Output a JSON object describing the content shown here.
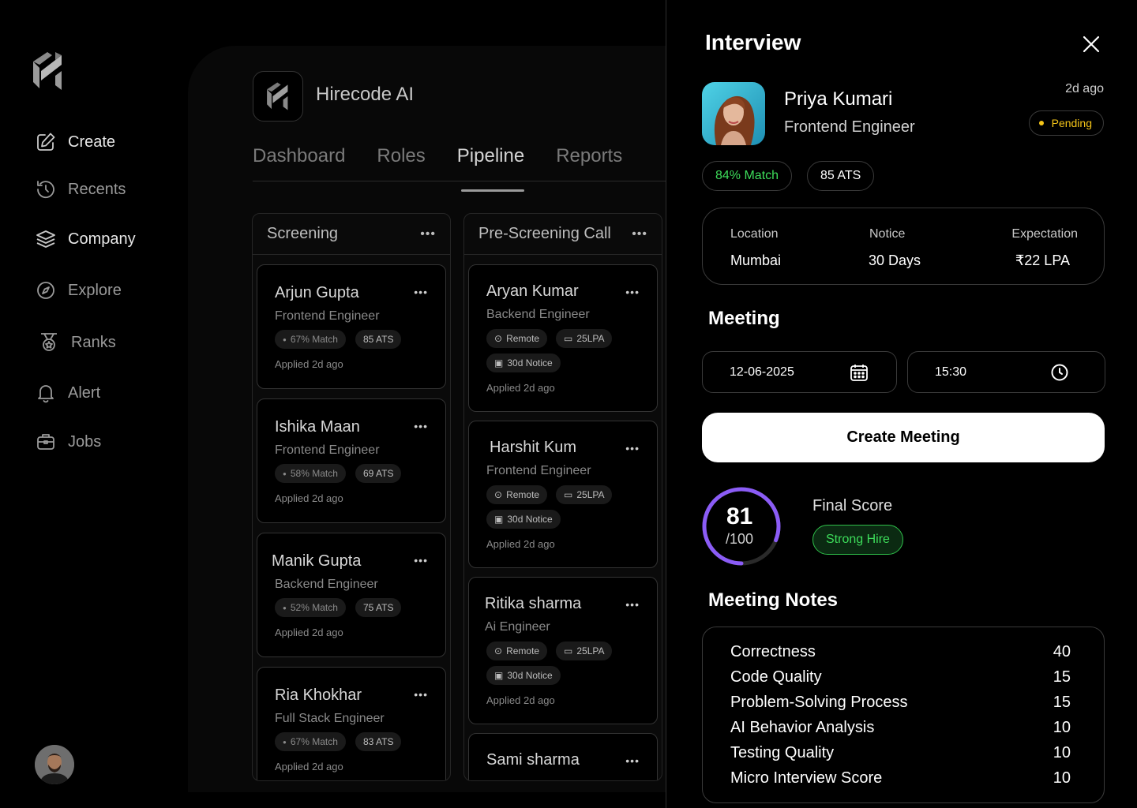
{
  "sidebar": {
    "items": [
      {
        "label": "Create",
        "icon": "edit-icon"
      },
      {
        "label": "Recents",
        "icon": "history-icon"
      },
      {
        "label": "Company",
        "icon": "layers-icon"
      },
      {
        "label": "Explore",
        "icon": "compass-icon"
      },
      {
        "label": "Ranks",
        "icon": "medal-icon"
      },
      {
        "label": "Alert",
        "icon": "bell-icon"
      },
      {
        "label": "Jobs",
        "icon": "briefcase-icon"
      }
    ]
  },
  "header": {
    "brand": "Hirecode AI"
  },
  "tabs": [
    {
      "label": "Dashboard",
      "active": false
    },
    {
      "label": "Roles",
      "active": false
    },
    {
      "label": "Pipeline",
      "active": true
    },
    {
      "label": "Reports",
      "active": false
    }
  ],
  "columns": [
    {
      "title": "Screening",
      "cards": [
        {
          "name": "Arjun Gupta",
          "role": "Frontend Engineer",
          "match": "67% Match",
          "ats": "85 ATS",
          "applied": "Applied 2d ago"
        },
        {
          "name": "Ishika Maan",
          "role": "Frontend Engineer",
          "match": "58% Match",
          "ats": "69 ATS",
          "applied": "Applied 2d ago"
        },
        {
          "name": "Manik Gupta",
          "role": "Backend Engineer",
          "match": "52% Match",
          "ats": "75 ATS",
          "applied": "Applied 2d ago"
        },
        {
          "name": "Ria Khokhar",
          "role": "Full Stack Engineer",
          "match": "67% Match",
          "ats": "83 ATS",
          "applied": "Applied 2d ago"
        }
      ]
    },
    {
      "title": "Pre-Screening Call",
      "cards": [
        {
          "name": "Aryan Kumar",
          "role": "Backend Engineer",
          "location": "Remote",
          "salary": "25LPA",
          "notice": "30d Notice",
          "applied": "Applied 2d ago"
        },
        {
          "name": "Harshit Kum",
          "role": "Frontend Engineer",
          "location": "Remote",
          "salary": "25LPA",
          "notice": "30d Notice",
          "applied": "Applied 2d ago"
        },
        {
          "name": "Ritika sharma",
          "role": "Ai Engineer",
          "location": "Remote",
          "salary": "25LPA",
          "notice": "30d Notice",
          "applied": "Applied 2d ago"
        },
        {
          "name": "Sami sharma"
        }
      ]
    }
  ],
  "panel": {
    "title": "Interview",
    "candidate": {
      "name": "Priya Kumari",
      "role": "Frontend Engineer",
      "time_ago": "2d ago",
      "status": "Pending",
      "match": "84% Match",
      "ats": "85 ATS"
    },
    "info": [
      {
        "label": "Location",
        "value": "Mumbai"
      },
      {
        "label": "Notice",
        "value": "30 Days"
      },
      {
        "label": "Expectation",
        "value": "₹22 LPA"
      }
    ],
    "meeting": {
      "title": "Meeting",
      "date": "12-06-2025",
      "time": "15:30",
      "button": "Create Meeting"
    },
    "score": {
      "value": "81",
      "denominator": "/100",
      "fraction": 0.81,
      "label": "Final Score",
      "verdict": "Strong Hire"
    },
    "notes": {
      "title": "Meeting Notes",
      "rows": [
        {
          "label": "Correctness",
          "value": "40"
        },
        {
          "label": "Code Quality",
          "value": "15"
        },
        {
          "label": "Problem-Solving Process",
          "value": "15"
        },
        {
          "label": "AI Behavior Analysis",
          "value": "10"
        },
        {
          "label": "Testing Quality",
          "value": "10"
        },
        {
          "label": "Micro Interview Score",
          "value": "10"
        }
      ]
    }
  },
  "colors": {
    "accent": "#8b5cf6",
    "success": "#3ddc5a",
    "pending": "#f5c518"
  }
}
